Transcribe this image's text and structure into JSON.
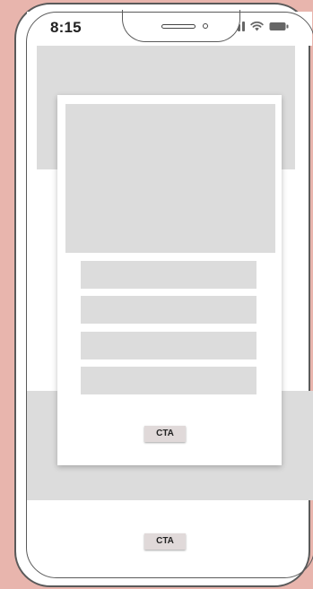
{
  "status_bar": {
    "time": "8:15",
    "icons": [
      "signal-icon",
      "wifi-icon",
      "battery-icon"
    ]
  },
  "hero": {
    "placeholder": "image-placeholder"
  },
  "card": {
    "image": "image-placeholder",
    "text_lines": 4,
    "cta_label": "CTA"
  },
  "footer": {
    "cta_label": "CTA"
  },
  "colors": {
    "background": "#e8b5ad",
    "placeholder": "#dcdcdc",
    "frame": "#5a5a5a",
    "button": "#e0d9d9"
  }
}
